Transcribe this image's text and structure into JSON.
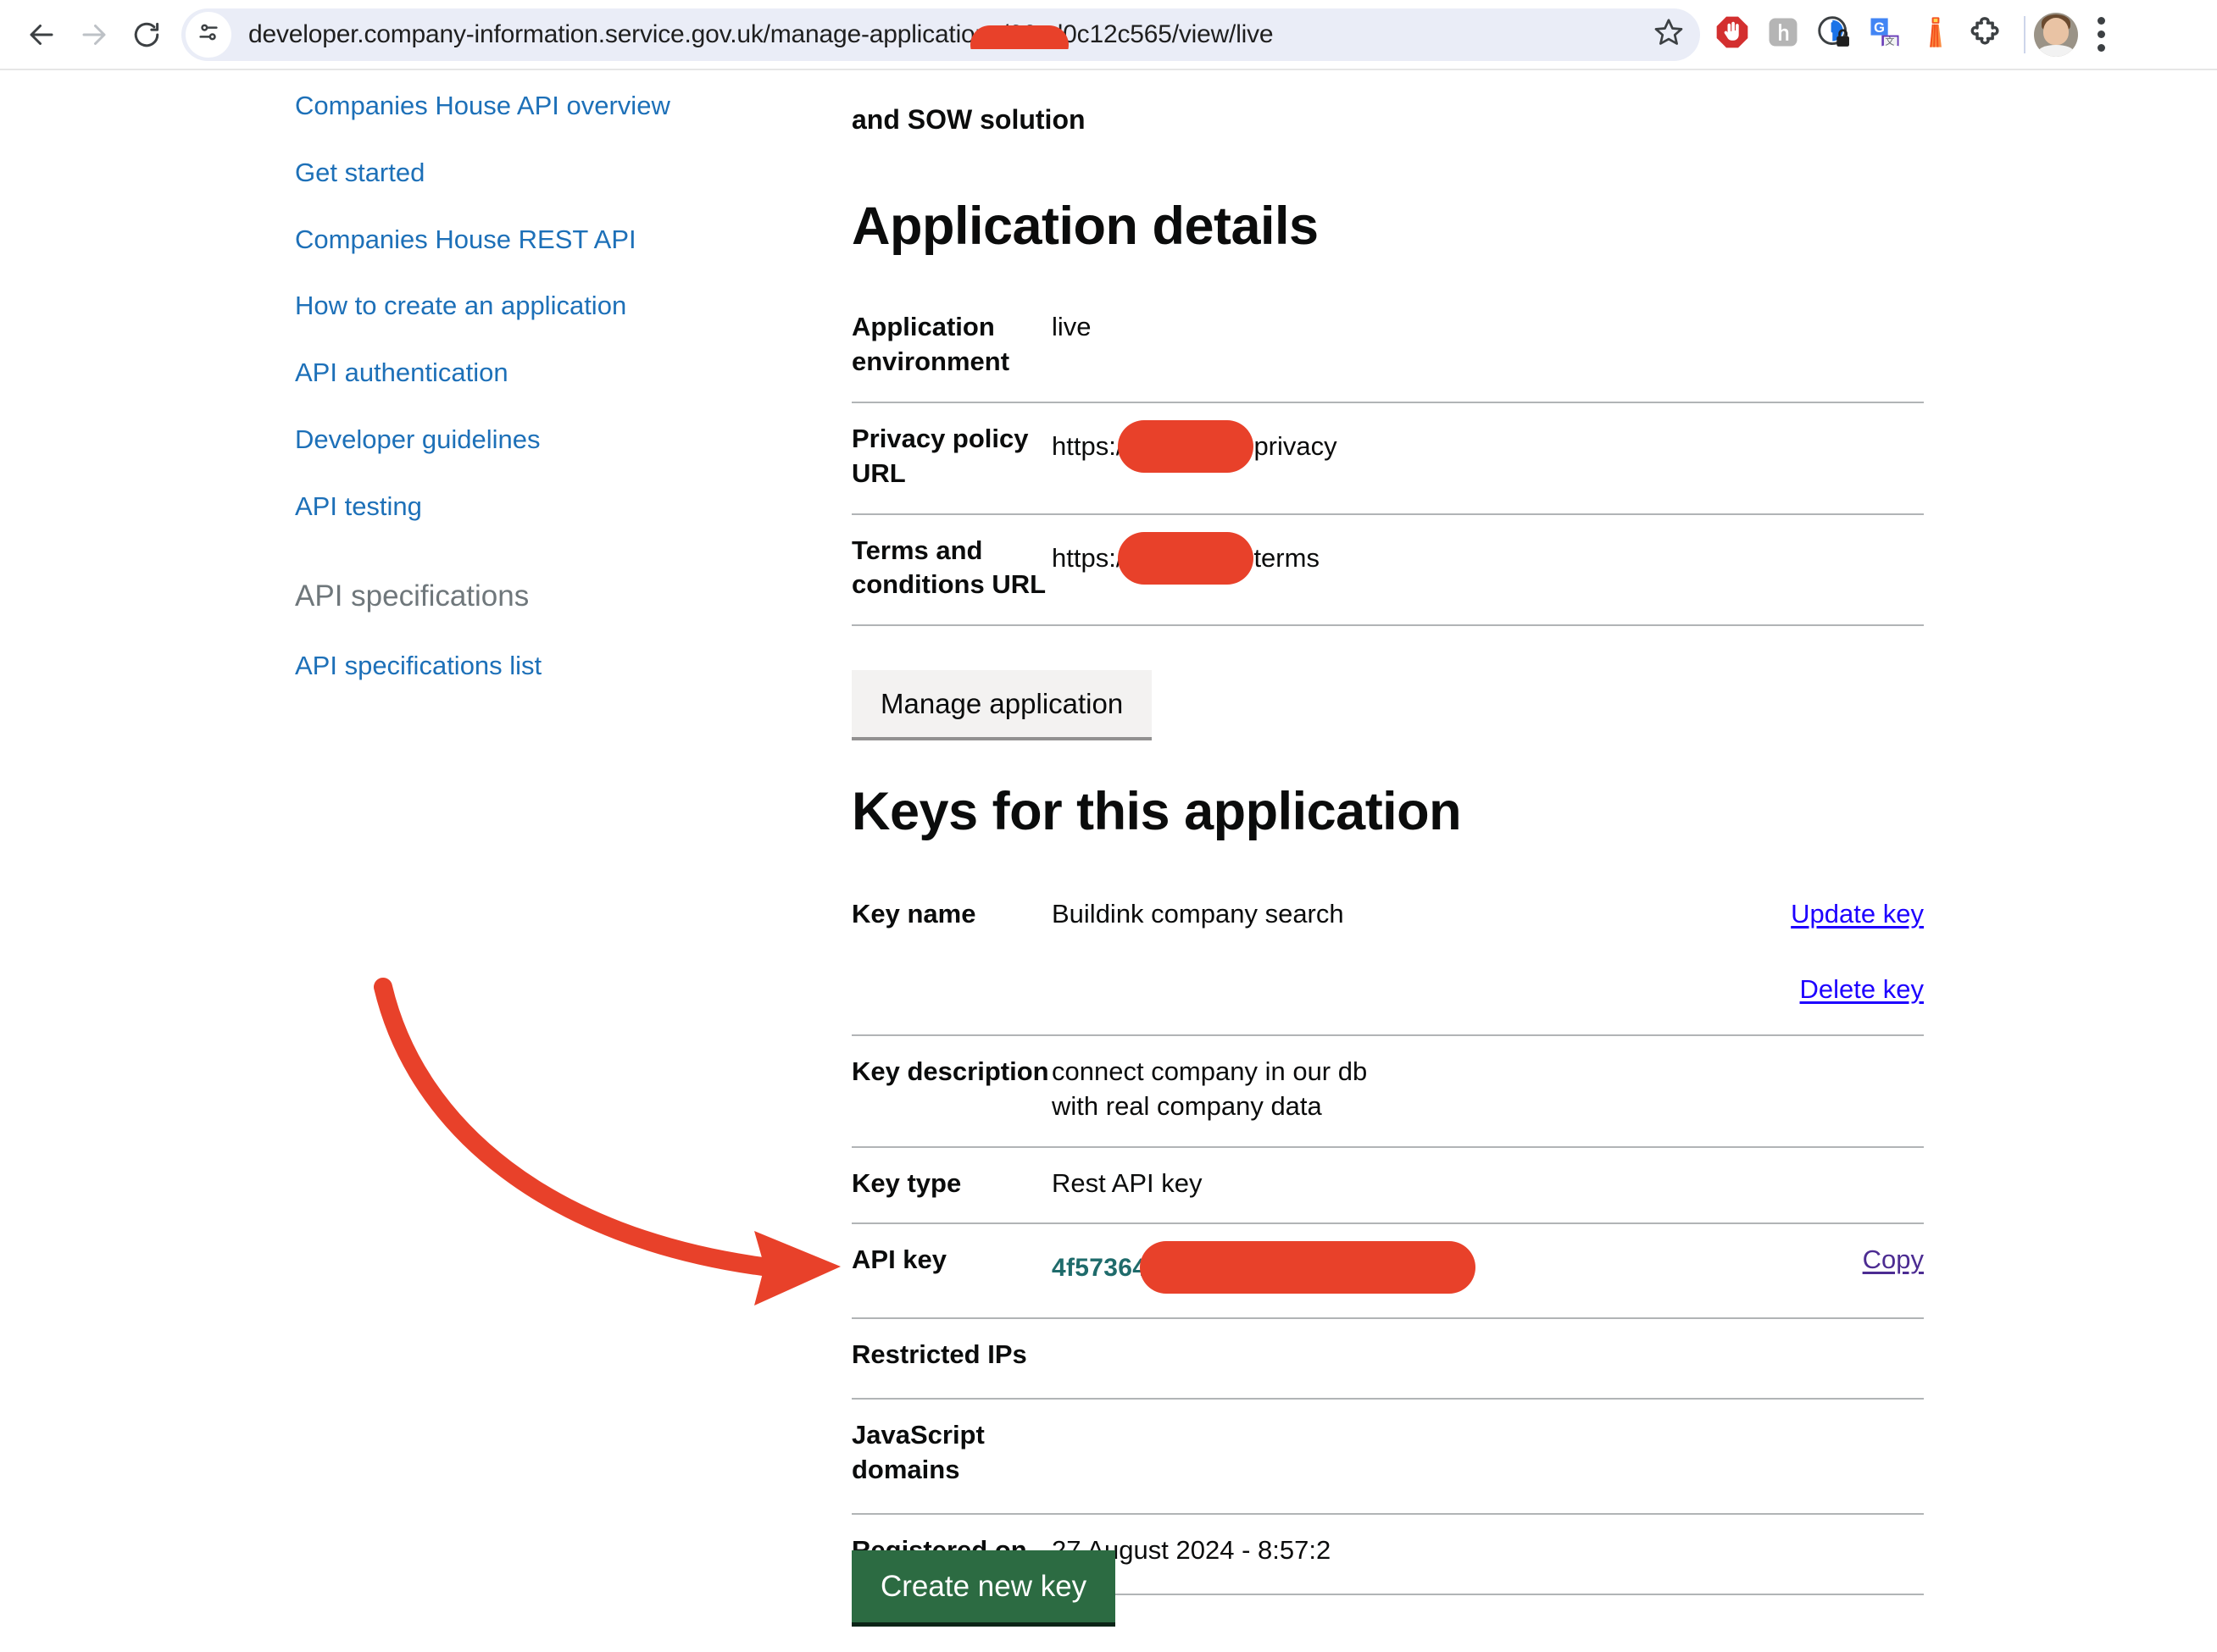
{
  "browser": {
    "back_icon": "back-arrow-icon",
    "forward_icon": "forward-arrow-icon",
    "reload_icon": "reload-icon",
    "site_settings_icon": "site-settings-sliders-icon",
    "url_prefix": "developer.company-information.service.gov.uk/manage-applications/66cd0c12c565",
    "url_suffix": "/view/live",
    "bookmark_icon": "bookmark-star-icon",
    "extensions": [
      {
        "name": "adblock-stop-hand-icon"
      },
      {
        "name": "hypothesis-h-icon"
      },
      {
        "name": "privacy-lock-icon"
      },
      {
        "name": "google-translate-icon"
      },
      {
        "name": "lighthouse-icon"
      },
      {
        "name": "extensions-puzzle-icon"
      }
    ],
    "avatar_name": "profile-avatar",
    "menu_icon": "chrome-menu-kebab-icon"
  },
  "sidebar": {
    "links": [
      {
        "label": "Companies House API overview"
      },
      {
        "label": "Get started"
      },
      {
        "label": "Companies House REST API"
      },
      {
        "label": "How to create an application"
      },
      {
        "label": "API authentication"
      },
      {
        "label": "Developer guidelines"
      },
      {
        "label": "API testing"
      }
    ],
    "section_title": "API specifications",
    "section_links": [
      {
        "label": "API specifications list"
      }
    ]
  },
  "main": {
    "lead_fragment": "and SOW solution",
    "application_details": {
      "heading": "Application details",
      "rows": [
        {
          "key": "Application environment",
          "value": "live",
          "redacted": false
        },
        {
          "key": "Privacy policy URL",
          "value_before": "https:/",
          "value_after": "privacy",
          "redacted": true
        },
        {
          "key": "Terms and conditions URL",
          "value_before": "https:/",
          "value_after": "terms",
          "redacted": true
        }
      ],
      "manage_button": "Manage application"
    },
    "keys_section": {
      "heading": "Keys for this application",
      "rows": [
        {
          "key": "Key name",
          "value": "Buildink company search",
          "action_primary": "Update key",
          "action_secondary": "Delete key"
        },
        {
          "key": "Key description",
          "value": "connect company in our db with real company data"
        },
        {
          "key": "Key type",
          "value": "Rest API key"
        },
        {
          "key": "API key",
          "value_visible": "4f57364",
          "redacted": true,
          "action_copy": "Copy"
        },
        {
          "key": "Restricted IPs",
          "value": ""
        },
        {
          "key": "JavaScript domains",
          "value": ""
        },
        {
          "key": "Registered on",
          "value": "27 August 2024 - 8:57:2"
        }
      ],
      "create_button": "Create new key"
    }
  },
  "annotation": {
    "arrow_name": "red-annotation-arrow",
    "arrow_color": "#e8412a"
  },
  "colors": {
    "link_blue": "#1d70b8",
    "raw_link_blue": "#1d00ff",
    "visited_purple": "#4c2c92",
    "redaction_red": "#e8412a",
    "govuk_green": "#2c6b42",
    "apikey_teal": "#1f6b6b",
    "rule_grey": "#b1b4b6"
  }
}
